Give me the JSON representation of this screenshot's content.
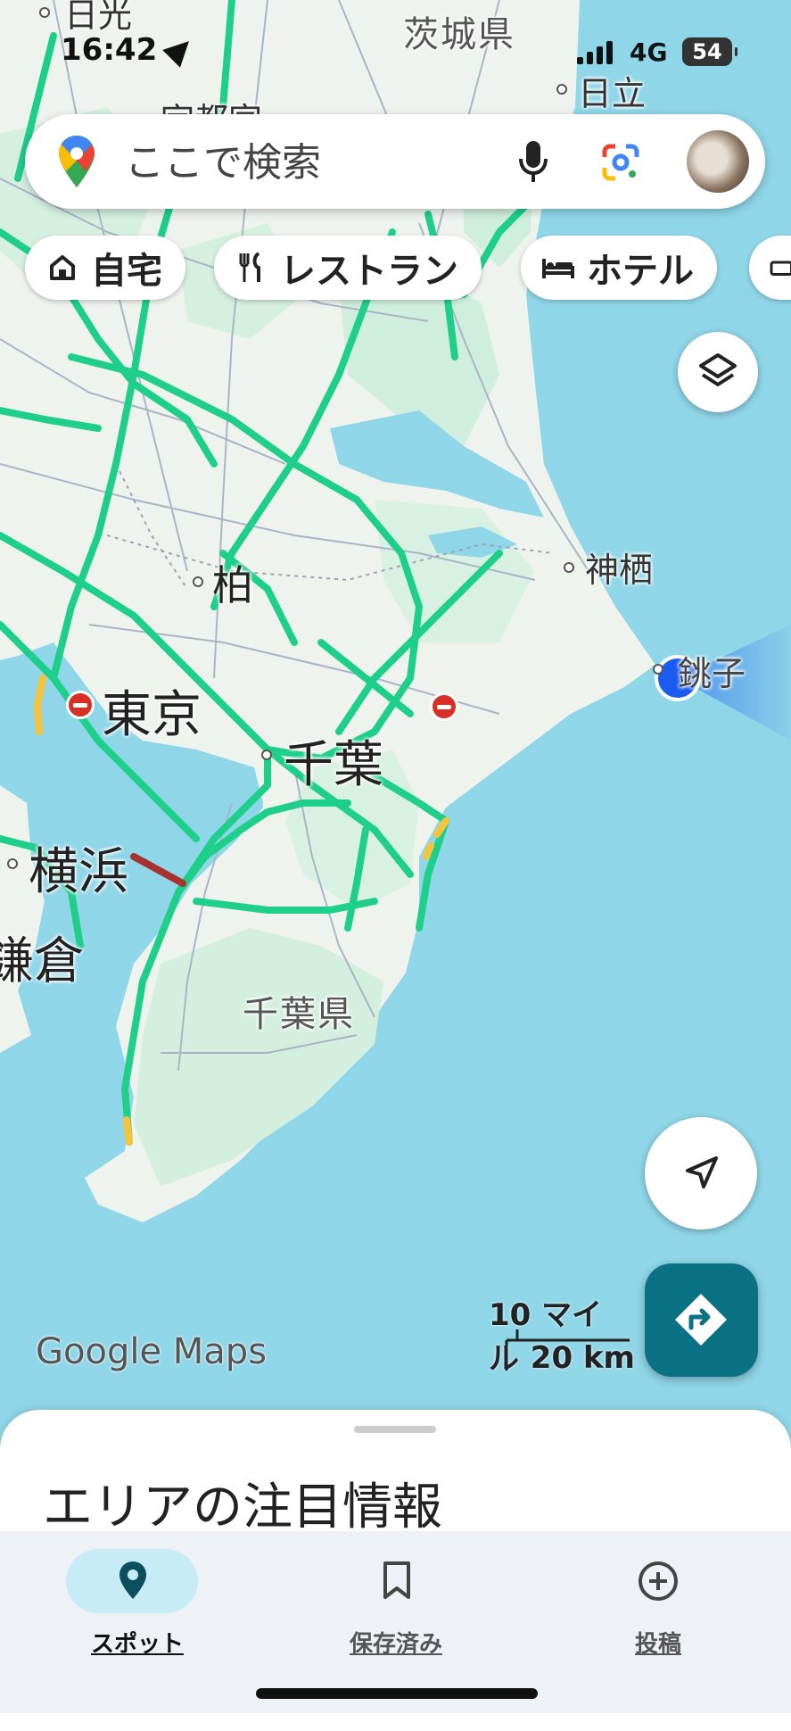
{
  "status_bar": {
    "time": "16:42",
    "network": "4G",
    "battery": "54"
  },
  "search": {
    "placeholder": "ここで検索"
  },
  "chips": [
    {
      "label": "自宅",
      "icon": "home-icon"
    },
    {
      "label": "レストラン",
      "icon": "restaurant-icon"
    },
    {
      "label": "ホテル",
      "icon": "hotel-icon"
    }
  ],
  "map_labels": {
    "nikko": "日光",
    "ibaraki_pref": "茨城県",
    "hitachi": "日立",
    "utsunomiya": "宇都宮",
    "kamisu": "神栖",
    "kashiwa": "柏",
    "choshi": "銚子",
    "tokyo": "東京",
    "chiba": "千葉",
    "yokohama": "横浜",
    "kamakura": "鎌倉",
    "chiba_pref": "千葉県"
  },
  "scale": {
    "miles": "10 マイル",
    "km": "20 km"
  },
  "watermark": {
    "brand": "Google",
    "product": "Maps"
  },
  "sheet": {
    "title": "エリアの注目情報"
  },
  "bottom_nav": [
    {
      "label": "スポット",
      "icon": "pin-icon",
      "active": true
    },
    {
      "label": "保存済み",
      "icon": "bookmark-icon",
      "active": false
    },
    {
      "label": "投稿",
      "icon": "add-circle-icon",
      "active": false
    }
  ],
  "colors": {
    "water": "#8fd6e8",
    "land": "#eef3ee",
    "green_area": "#cfeedd",
    "traffic_green": "#1ecf8a",
    "traffic_yellow": "#f6c33a",
    "traffic_red": "#a8322d",
    "location_blue": "#1a5cf0",
    "directions_teal": "#0b7285",
    "nav_active_pill": "#c7ecf6"
  }
}
